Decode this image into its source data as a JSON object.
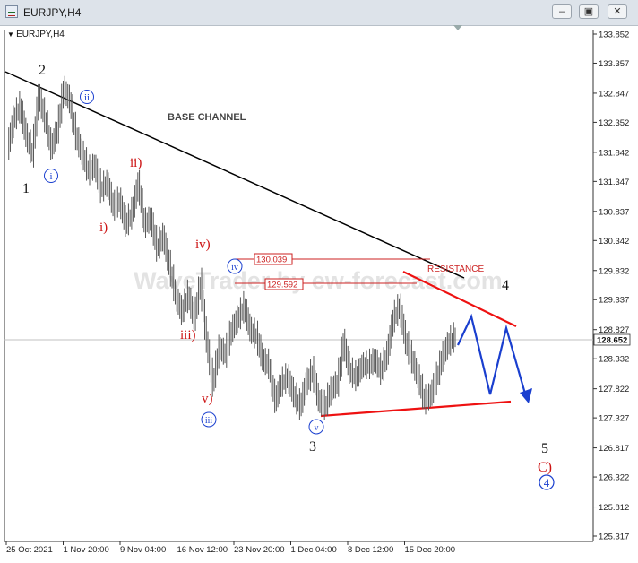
{
  "window": {
    "title": "EURJPY,H4",
    "minimize_label": "–",
    "restore_label": "▣",
    "close_label": "✕"
  },
  "chart": {
    "symbol_label": "EURJPY,H4",
    "current_price_label": "128.652",
    "watermark": "WaveTrader by ew-forecast.com",
    "annotation_base_channel": "BASE CHANNEL",
    "annotation_resistance": "RESISTANCE",
    "level_high": "130.039",
    "level_low": "129.592"
  },
  "chart_data": {
    "type": "line",
    "title": "",
    "y_ticks": [
      "133.852",
      "133.357",
      "132.847",
      "132.352",
      "131.842",
      "131.347",
      "130.837",
      "130.342",
      "129.832",
      "129.337",
      "128.827",
      "128.332",
      "127.822",
      "127.327",
      "126.817",
      "126.322",
      "125.812",
      "125.317"
    ],
    "x_ticks": [
      "25 Oct 2021",
      "1 Nov 20:00",
      "9 Nov 04:00",
      "16 Nov 12:00",
      "23 Nov 20:00",
      "1 Dec 04:00",
      "8 Dec 12:00",
      "15 Dec 20:00"
    ],
    "ylim": [
      125.317,
      133.852
    ],
    "price_series": [
      131.9,
      132.4,
      132.6,
      132.1,
      131.8,
      132.8,
      132.4,
      131.9,
      132.2,
      132.9,
      132.7,
      132.1,
      131.8,
      131.5,
      131.6,
      131.2,
      131.3,
      130.9,
      131.0,
      130.6,
      130.8,
      131.3,
      130.6,
      130.7,
      130.2,
      130.4,
      129.9,
      129.4,
      129.1,
      129.4,
      129.0,
      129.6,
      128.6,
      127.9,
      128.5,
      128.4,
      128.8,
      129.0,
      129.2,
      128.8,
      128.7,
      128.3,
      128.2,
      127.6,
      127.9,
      128.0,
      127.7,
      127.5,
      127.9,
      128.1,
      127.6,
      127.5,
      127.8,
      127.9,
      128.6,
      128.1,
      128.0,
      128.2,
      128.2,
      128.3,
      128.1,
      128.4,
      129.0,
      129.2,
      128.6,
      128.3,
      128.0,
      127.6,
      127.7,
      128.0,
      128.4,
      128.6,
      128.7
    ],
    "wave_labels": [
      "1",
      "2",
      "i",
      "ii",
      "i)",
      "ii)",
      "iii)",
      "iv)",
      "v)",
      "iii",
      "iv",
      "v",
      "3",
      "4",
      "5",
      "C)",
      "4"
    ]
  }
}
